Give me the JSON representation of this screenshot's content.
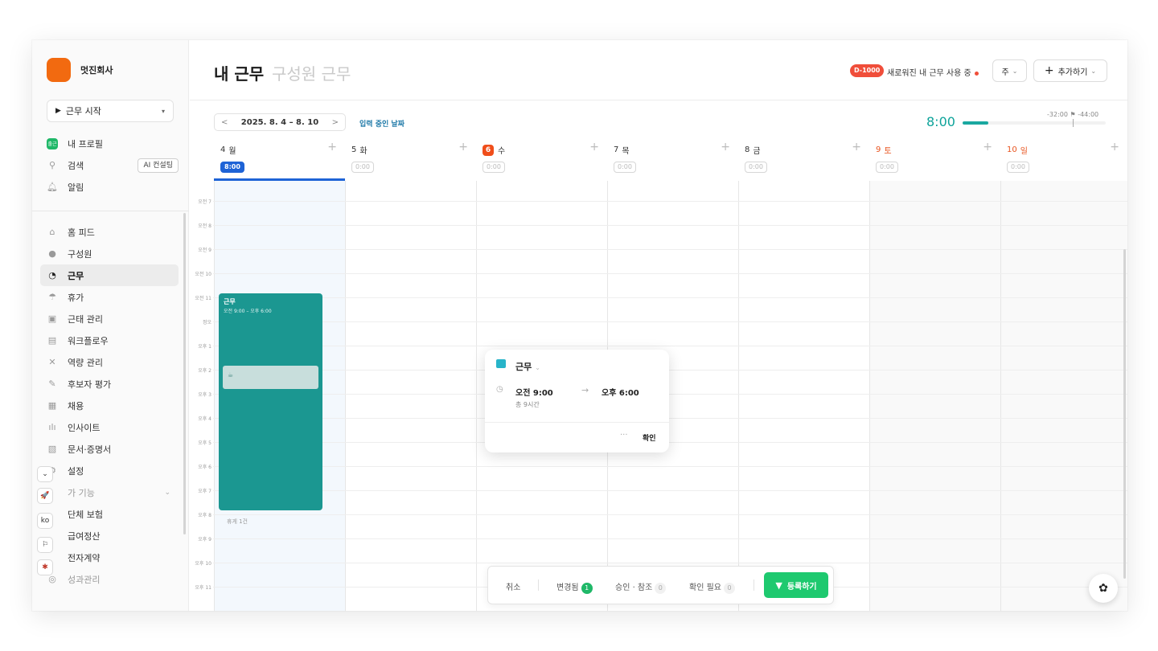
{
  "sidebar": {
    "company": "멋진회사",
    "start_button": "근무 시작",
    "profile_badge": "출근",
    "top_items": [
      {
        "label": "내 프로필",
        "icon": "profile-badge-icon"
      },
      {
        "label": "검색",
        "icon": "search-icon"
      },
      {
        "label": "알림",
        "icon": "bell-icon"
      }
    ],
    "ai_button": "AI 컨설팅",
    "items": [
      {
        "label": "홈 피드",
        "icon": "home-icon"
      },
      {
        "label": "구성원",
        "icon": "people-icon"
      },
      {
        "label": "근무",
        "icon": "clock-icon"
      },
      {
        "label": "휴가",
        "icon": "umbrella-icon"
      },
      {
        "label": "근태 관리",
        "icon": "calendar-check-icon"
      },
      {
        "label": "워크플로우",
        "icon": "document-icon"
      },
      {
        "label": "역량 관리",
        "icon": "skill-icon"
      },
      {
        "label": "후보자 평가",
        "icon": "evaluation-icon"
      },
      {
        "label": "채용",
        "icon": "briefcase-icon"
      },
      {
        "label": "인사이트",
        "icon": "bar-chart-icon"
      },
      {
        "label": "문서·증명서",
        "icon": "file-icon"
      },
      {
        "label": "설정",
        "icon": "gear-icon"
      }
    ],
    "more_section": "가 기능",
    "extra_items": [
      {
        "label": "단체 보험"
      },
      {
        "label": "급여정산"
      },
      {
        "label": "전자계약"
      },
      {
        "label": "성과관리"
      }
    ],
    "float_buttons": {
      "collapse": "⌄",
      "rocket": "🚀",
      "lang": "ko",
      "flag": "⚐",
      "gear": "✱"
    }
  },
  "header": {
    "title": "내 근무",
    "title_tab": "구성원 근무",
    "d_badge": "D-1000",
    "new_text": "새로워진 내 근무 사용 중",
    "view_select": "주",
    "add_button": "추가하기"
  },
  "toolbar": {
    "prev": "<",
    "date_range": "2025. 8. 4 – 8. 10",
    "next": ">",
    "inputting_link": "입력 중인 날짜",
    "total_time": "8:00",
    "progress_fraction": 0.18,
    "progress_labels": "-32:00 ⚑ -44:00"
  },
  "days": [
    {
      "num": "4",
      "name": "월",
      "time": "8:00"
    },
    {
      "num": "5",
      "name": "화",
      "time": "0:00"
    },
    {
      "num": "6",
      "name": "수",
      "time": "0:00"
    },
    {
      "num": "7",
      "name": "목",
      "time": "0:00"
    },
    {
      "num": "8",
      "name": "금",
      "time": "0:00"
    },
    {
      "num": "9",
      "name": "토",
      "time": "0:00"
    },
    {
      "num": "10",
      "name": "일",
      "time": "0:00"
    }
  ],
  "hours": [
    "오전 7",
    "오전 8",
    "오전 9",
    "오전 10",
    "오전 11",
    "정오",
    "오후 1",
    "오후 2",
    "오후 3",
    "오후 4",
    "오후 5",
    "오후 6",
    "오후 7",
    "오후 8",
    "오후 9",
    "오후 10",
    "오후 11"
  ],
  "event": {
    "title": "근무",
    "time": "오전 9:00 – 오후 6:00",
    "break_note": "휴게 1건"
  },
  "popup": {
    "title": "근무",
    "from": "오전 9:00",
    "arrow": "→",
    "to": "오후 6:00",
    "total": "총 9시간",
    "more": "···",
    "confirm": "확인"
  },
  "action_bar": {
    "cancel": "취소",
    "changed": "변경됨",
    "changed_count": "1",
    "approval": "승인 · 참조",
    "approval_count": "0",
    "needs_check": "확인 필요",
    "needs_check_count": "0",
    "submit": "등록하기"
  },
  "colors": {
    "accent": "#1e63d6",
    "event": "#1b9791",
    "brand": "#f26a10",
    "submit": "#1ec96f",
    "today": "#f04e1a"
  }
}
